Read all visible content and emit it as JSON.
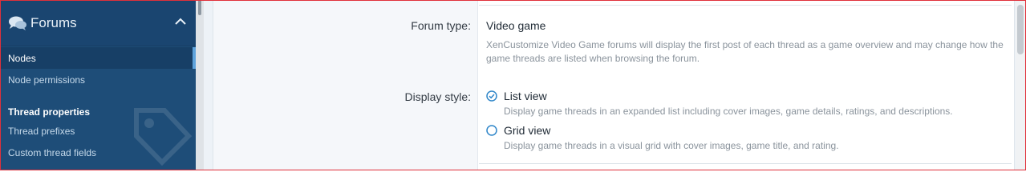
{
  "sidebar": {
    "title": "Forums",
    "items": [
      {
        "label": "Nodes",
        "active": true
      },
      {
        "label": "Node permissions",
        "active": false
      }
    ],
    "section_title": "Thread properties",
    "section_items": [
      {
        "label": "Thread prefixes"
      },
      {
        "label": "Custom thread fields"
      }
    ]
  },
  "form": {
    "forum_type": {
      "label": "Forum type:",
      "value": "Video game",
      "description": "XenCustomize Video Game forums will display the first post of each thread as a game overview and may change how the game threads are listed when browsing the forum."
    },
    "display_style": {
      "label": "Display style:",
      "options": [
        {
          "label": "List view",
          "description": "Display game threads in an expanded list including cover images, game details, ratings, and descriptions.",
          "selected": true
        },
        {
          "label": "Grid view",
          "description": "Display game threads in a visual grid with cover images, game title, and rating.",
          "selected": false
        }
      ]
    }
  },
  "colors": {
    "sidebar_bg": "#1e4d78",
    "accent": "#2f86c9",
    "frame": "#e0303a"
  }
}
